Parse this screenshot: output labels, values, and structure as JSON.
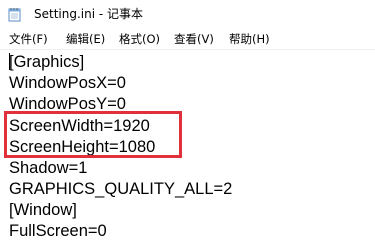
{
  "window": {
    "title": "Setting.ini - 记事本"
  },
  "menu": [
    "文件(F)",
    "编辑(E)",
    "格式(O)",
    "查看(V)",
    "帮助(H)"
  ],
  "content_lines": [
    "[Graphics]",
    "WindowPosX=0",
    "WindowPosY=0",
    "ScreenWidth=1920",
    "ScreenHeight=1080",
    "Shadow=1",
    "GRAPHICS_QUALITY_ALL=2",
    "[Window]",
    "FullScreen=0"
  ],
  "annotation": {
    "color": "#e0313a",
    "highlighted_lines": [
      "ScreenWidth=1920",
      "ScreenHeight=1080"
    ]
  },
  "icons": {
    "app": "notepad-icon"
  }
}
